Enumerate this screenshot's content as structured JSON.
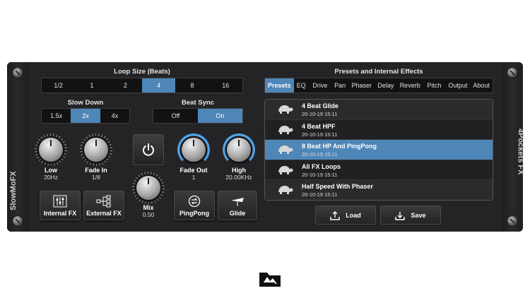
{
  "plugin": {
    "left_label": "SlowMoFX",
    "right_label": "4Pockets FX"
  },
  "loop_size": {
    "title": "Loop Size (Beats)",
    "options": [
      "1/2",
      "1",
      "2",
      "4",
      "8",
      "16"
    ],
    "selected": "4"
  },
  "slow_down": {
    "title": "Slow Down",
    "options": [
      "1.5x",
      "2x",
      "4x"
    ],
    "selected": "2x"
  },
  "beat_sync": {
    "title": "Beat Sync",
    "options": [
      "Off",
      "On"
    ],
    "selected": "On"
  },
  "knobs": {
    "low": {
      "label": "Low",
      "value": "20Hz"
    },
    "fade_in": {
      "label": "Fade In",
      "value": "1/8"
    },
    "mix": {
      "label": "Mix",
      "value": "0.50"
    },
    "fade_out": {
      "label": "Fade Out",
      "value": "1"
    },
    "high": {
      "label": "High",
      "value": "20.00KHz"
    }
  },
  "buttons": {
    "internal_fx": "Internal FX",
    "external_fx": "External FX",
    "pingpong": "PingPong",
    "glide": "Glide",
    "load": "Load",
    "save": "Save"
  },
  "effects": {
    "title": "Presets and Internal Effects",
    "tabs": [
      "Presets",
      "EQ",
      "Drive",
      "Pan",
      "Phaser",
      "Delay",
      "Reverb",
      "Pitch",
      "Output",
      "About"
    ],
    "selected_tab": "Presets"
  },
  "presets": [
    {
      "name": "4 Beat Glide",
      "date": "20-10-19 15:11"
    },
    {
      "name": "4 Beat HPF",
      "date": "20-10-19 15:11"
    },
    {
      "name": "8 Beat HP And PingPong",
      "date": "20-10-19 15:11"
    },
    {
      "name": "All FX Loops",
      "date": "20-10-19 15:11"
    },
    {
      "name": "Half Speed With Phaser",
      "date": "20-10-19 15:11"
    }
  ],
  "selected_preset_index": 2,
  "colors": {
    "accent": "#4f86b8",
    "knob_ring_active": "#4fa3e6"
  },
  "icons": {
    "bottom": "folder-open-icon"
  }
}
